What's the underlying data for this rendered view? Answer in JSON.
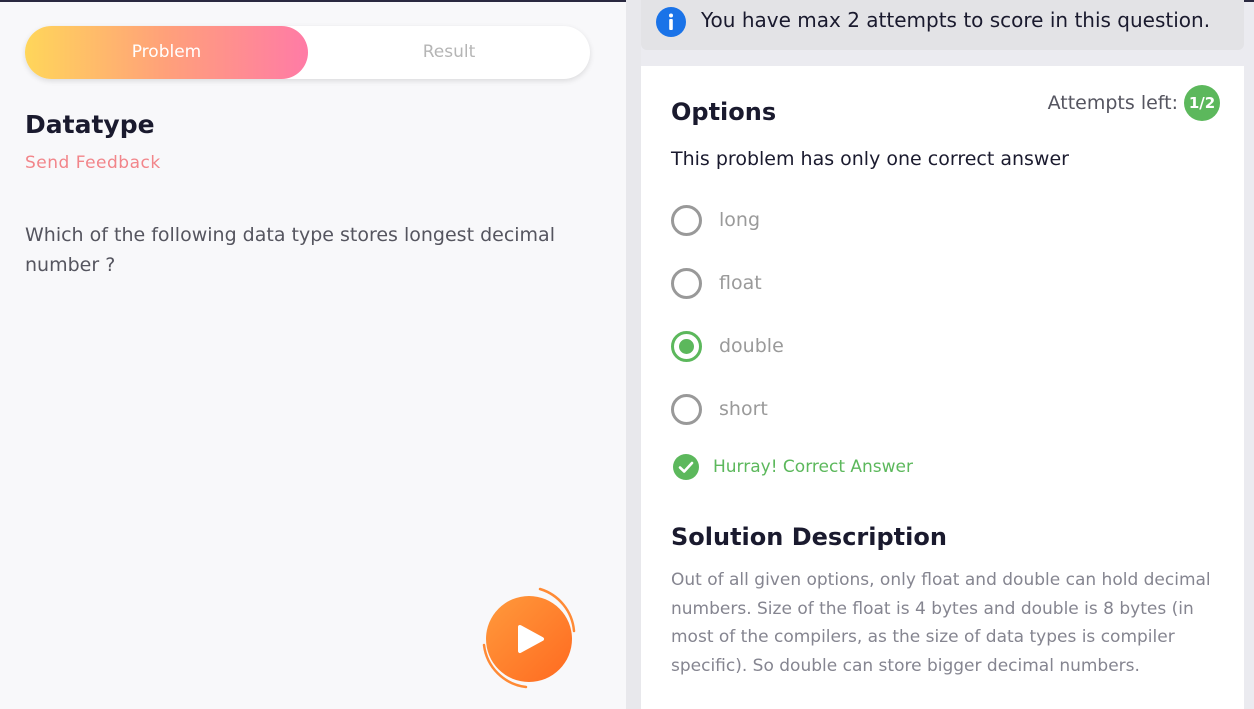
{
  "tabs": {
    "problem": "Problem",
    "result": "Result"
  },
  "problem": {
    "title": "Datatype",
    "feedback": "Send Feedback",
    "question": "Which of the following data type stores longest decimal number ?"
  },
  "play_button": {
    "icon": "play-icon",
    "color": "#ff7f2a"
  },
  "notice": {
    "icon": "info-icon",
    "text": "You have max 2 attempts to score in this question."
  },
  "options": {
    "title": "Options",
    "attempts_label": "Attempts left:",
    "attempts_value": "1/2",
    "subtitle": "This problem has only one correct answer",
    "items": [
      {
        "label": "long",
        "selected": false
      },
      {
        "label": "float",
        "selected": false
      },
      {
        "label": "double",
        "selected": true
      },
      {
        "label": "short",
        "selected": false
      }
    ],
    "result_text": "Hurray! Correct Answer",
    "success_color": "#5cb85c"
  },
  "solution": {
    "title": "Solution Description",
    "text": "Out of all given options, only float and double can hold decimal numbers. Size of the float is 4 bytes and double is 8 bytes (in most of the compilers, as the size of data types is compiler specific). So double can store bigger decimal numbers."
  }
}
